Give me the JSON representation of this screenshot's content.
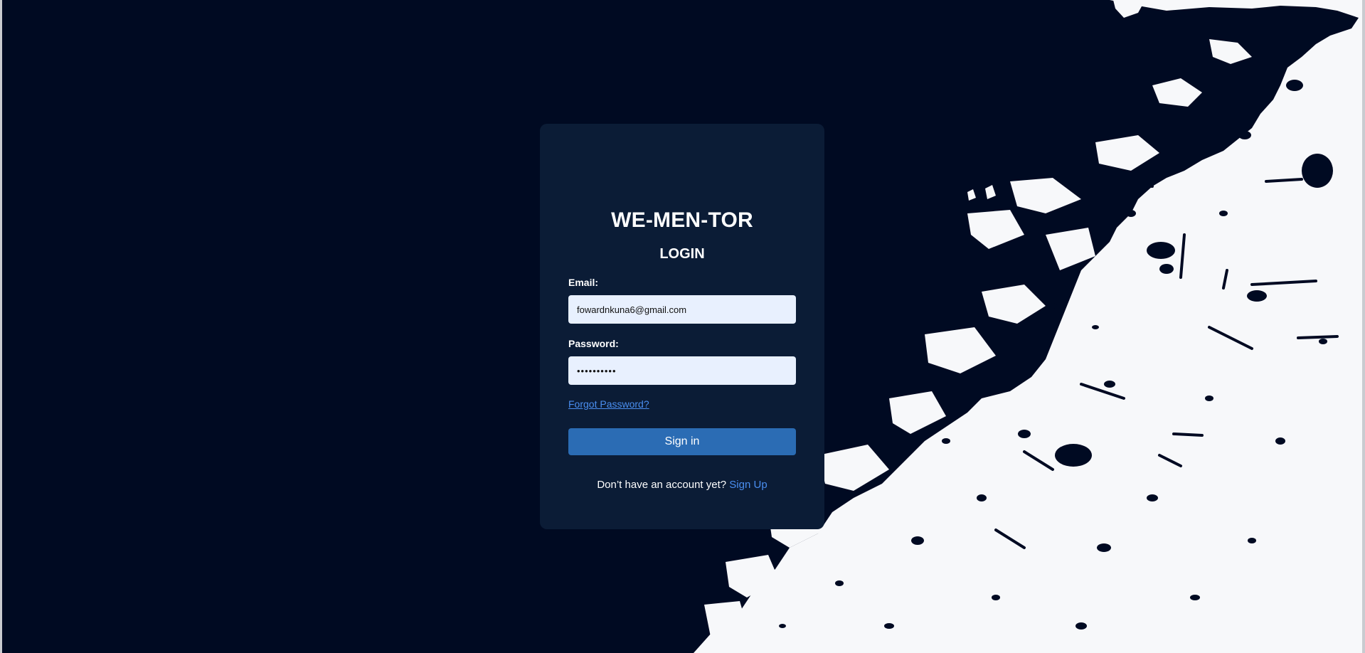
{
  "brand": {
    "title": "WE-MEN-TOR"
  },
  "form": {
    "heading": "LOGIN",
    "email_label": "Email:",
    "email_value": "fowardnkuna6@gmail.com",
    "password_label": "Password:",
    "password_value": "••••••••••",
    "forgot_label": "Forgot Password?",
    "signin_label": "Sign in"
  },
  "footer": {
    "prompt": "Don’t have an account yet?",
    "signup_label": "Sign Up"
  },
  "colors": {
    "page_background": "#000a22",
    "card_background": "#0b1c36",
    "input_background": "#e8f0fe",
    "button_background": "#2b6cb4",
    "link": "#4a8ef0",
    "splash": "#f7f8fa"
  }
}
